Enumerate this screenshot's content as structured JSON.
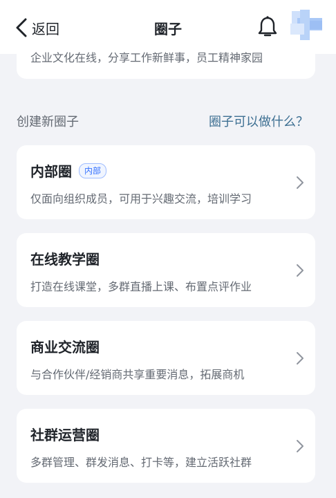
{
  "header": {
    "back_label": "返回",
    "title": "圈子"
  },
  "top_card": {
    "description": "企业文化在线，分享工作新鲜事，员工精神家园"
  },
  "section": {
    "label": "创建新圈子",
    "link": "圈子可以做什么？"
  },
  "circles": [
    {
      "title": "内部圈",
      "badge": "内部",
      "description": "仅面向组织成员，可用于兴趣交流，培训学习"
    },
    {
      "title": "在线教学圈",
      "description": "打造在线课堂，多群直播上课、布置点评作业"
    },
    {
      "title": "商业交流圈",
      "description": "与合作伙伴/经销商共享重要消息，拓展商机"
    },
    {
      "title": "社群运营圈",
      "description": "多群管理、群发消息、打卡等，建立活跃社群"
    }
  ],
  "colors": {
    "background": "#f2f3f7",
    "card": "#ffffff",
    "link": "#3d6f92",
    "badge": "#3370ff"
  }
}
